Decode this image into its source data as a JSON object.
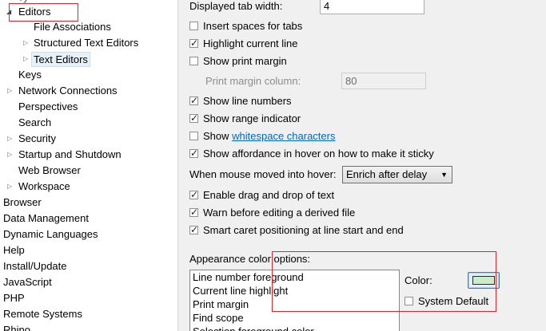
{
  "sidebar": {
    "partial_top": "Ty",
    "items": [
      {
        "label": "Editors",
        "expanded": true
      },
      {
        "label": "File Associations"
      },
      {
        "label": "Structured Text Editors"
      },
      {
        "label": "Text Editors",
        "selected": true
      },
      {
        "label": "Keys"
      },
      {
        "label": "Network Connections"
      },
      {
        "label": "Perspectives"
      },
      {
        "label": "Search"
      },
      {
        "label": "Security"
      },
      {
        "label": "Startup and Shutdown"
      },
      {
        "label": "Web Browser"
      },
      {
        "label": "Workspace"
      },
      {
        "label": "Browser"
      },
      {
        "label": "Data Management"
      },
      {
        "label": "Dynamic Languages"
      },
      {
        "label": "Help"
      },
      {
        "label": "Install/Update"
      },
      {
        "label": "JavaScript"
      },
      {
        "label": "PHP"
      },
      {
        "label": "Remote Systems"
      },
      {
        "label": "Rhino"
      }
    ]
  },
  "content": {
    "tab_width_label": "Displayed tab width:",
    "tab_width_value": "4",
    "insert_spaces": {
      "label": "Insert spaces for tabs",
      "checked": false
    },
    "highlight_line": {
      "label": "Highlight current line",
      "checked": true
    },
    "print_margin": {
      "label": "Show print margin",
      "checked": false
    },
    "print_margin_column_label": "Print margin column:",
    "print_margin_column_value": "80",
    "line_numbers": {
      "label": "Show line numbers",
      "checked": true
    },
    "range_indicator": {
      "label": "Show range indicator",
      "checked": true
    },
    "whitespace": {
      "prefix": "Show ",
      "link": "whitespace characters",
      "checked": false
    },
    "affordance": {
      "label": "Show affordance in hover on how to make it sticky",
      "checked": true
    },
    "hover_label": "When mouse moved into hover:",
    "hover_value": "Enrich after delay",
    "drag_drop": {
      "label": "Enable drag and drop of text",
      "checked": true
    },
    "warn_derived": {
      "label": "Warn before editing a derived file",
      "checked": true
    },
    "smart_caret": {
      "label": "Smart caret positioning at line start and end",
      "checked": true
    },
    "appearance_label": "Appearance color options:",
    "appearance_items": [
      "Line number foreground",
      "Current line highlight",
      "Print margin",
      "Find scope",
      "Selection foreground color"
    ],
    "color_label": "Color:",
    "color_value": "#c9ecc9",
    "system_default": {
      "label": "System Default",
      "checked": false
    }
  },
  "check_glyph": "✓",
  "tree_expanded_glyph": "◢",
  "tree_collapsed_glyph": "▷",
  "combo_arrow_glyph": "▼",
  "annotation_color": "#e0252b"
}
